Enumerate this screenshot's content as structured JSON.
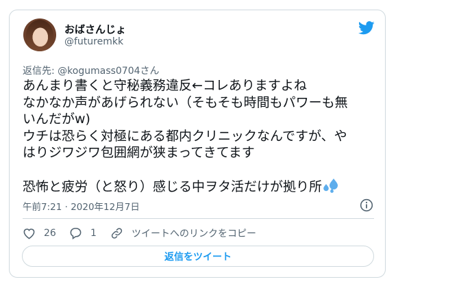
{
  "user": {
    "display_name": "おばさんじょ",
    "handle": "@futuremkk"
  },
  "tweet": {
    "reply_to": "返信先: @kogumass0704さん",
    "lines": [
      "あんまり書くと守秘義務違反←コレありますよね",
      "なかなか声があげられない（そもそも時間もパワーも無",
      "いんだがw)",
      "ウチは恐らく対極にある都内クリニックなんですが、や",
      "はりジワジワ包囲網が狭まってきてます",
      "",
      "恐怖と疲労（と怒り）感じる中ヲタ活だけが拠り所"
    ],
    "timestamp": "午前7:21 · 2020年12月7日"
  },
  "actions": {
    "like_count": "26",
    "reply_count": "1",
    "copy_link_label": "ツイートへのリンクをコピー"
  },
  "reply_button_label": "返信をツイート",
  "icons": {
    "logo": "twitter-bird-icon",
    "info": "info-icon",
    "like": "heart-icon",
    "reply": "reply-bubble-icon",
    "link": "link-icon",
    "emoji": "sweat-droplets-icon"
  },
  "colors": {
    "accent": "#1d9bf0",
    "secondary_text": "#536471",
    "border": "#cfd9de"
  }
}
